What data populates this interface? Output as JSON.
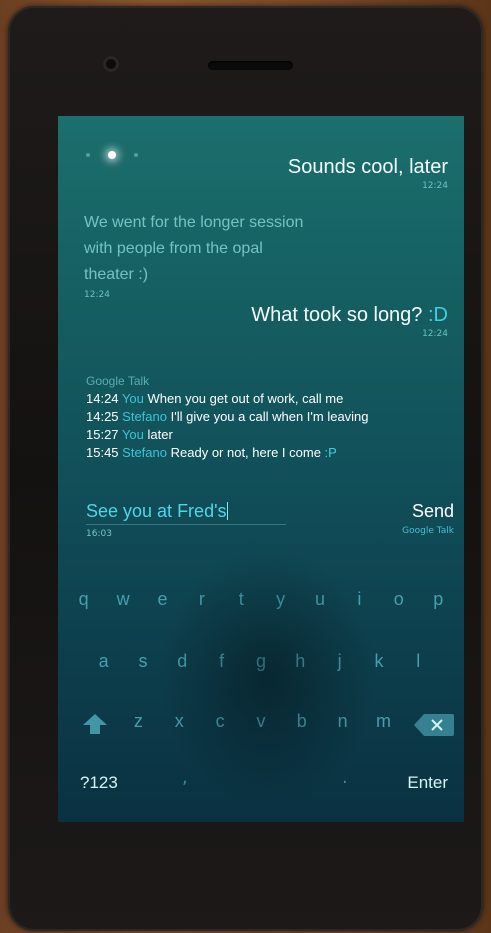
{
  "messages": [
    {
      "text": "Sounds cool, later",
      "time": "12:24"
    },
    {
      "text": "We went for the longer session with people from the opal theater :)",
      "time": "12:24"
    },
    {
      "text": "What took so long? ",
      "emoticon": ":D",
      "time": "12:24"
    }
  ],
  "history": {
    "service": "Google Talk",
    "rows": [
      {
        "time": "14:24",
        "who": "You",
        "text": "When you get out of work, call me"
      },
      {
        "time": "14:25",
        "who": "Stefano",
        "text": "I'll give you a call when I'm leaving"
      },
      {
        "time": "15:27",
        "who": "You",
        "text": "later"
      },
      {
        "time": "15:45",
        "who": "Stefano",
        "text": "Ready or not, here I come ",
        "emoticon": ":P"
      }
    ]
  },
  "compose": {
    "value": "See you at Fred's",
    "time": "16:03"
  },
  "send": {
    "label": "Send",
    "via": "Google Talk"
  },
  "keyboard": {
    "row1": [
      "q",
      "w",
      "e",
      "r",
      "t",
      "y",
      "u",
      "i",
      "o",
      "p"
    ],
    "row2": [
      "a",
      "s",
      "d",
      "f",
      "g",
      "h",
      "j",
      "k",
      "l"
    ],
    "row3": [
      "z",
      "x",
      "c",
      "v",
      "b",
      "n",
      "m"
    ],
    "symbols": "?123",
    "comma": ",",
    "period": ".",
    "enter": "Enter"
  },
  "icons": {
    "shift": "shift-icon",
    "backspace": "backspace-icon",
    "page_dot": "page-indicator-icon"
  },
  "colors": {
    "accent": "#3fc2d6",
    "screen_top": "#1b6f6d",
    "screen_bottom": "#0a3141"
  }
}
